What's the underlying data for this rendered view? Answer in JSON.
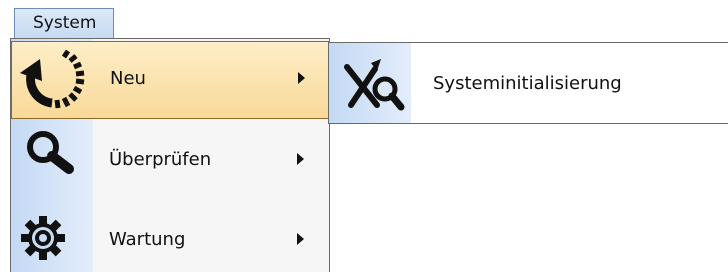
{
  "menubar": {
    "system_label": "System"
  },
  "dropdown": {
    "items": [
      {
        "label": "Neu",
        "icon": "refresh-icon",
        "highlighted": true,
        "has_submenu": true
      },
      {
        "label": "Überprüfen",
        "icon": "search-icon",
        "highlighted": false,
        "has_submenu": true
      },
      {
        "label": "Wartung",
        "icon": "gear-icon",
        "highlighted": false,
        "has_submenu": true
      }
    ]
  },
  "submenu": {
    "items": [
      {
        "label": "Systeminitialisierung",
        "icon": "tools-search-icon"
      }
    ]
  },
  "colors": {
    "highlight": "#f9d997",
    "gutter": "#c4d9f4",
    "menubar_active": "#c6daf2"
  }
}
